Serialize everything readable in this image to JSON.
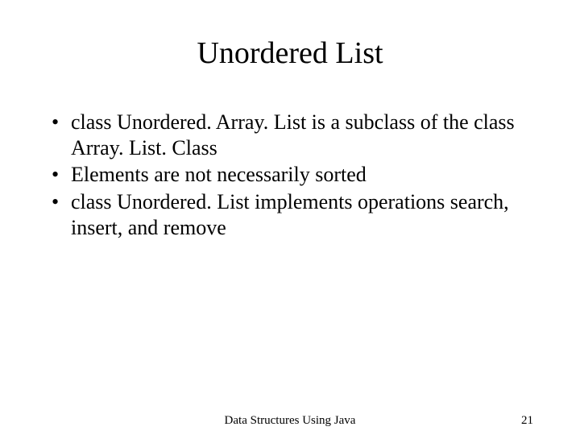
{
  "title": "Unordered List",
  "bullets": [
    "class Unordered. Array. List is a subclass of the class Array. List. Class",
    "Elements are not necessarily sorted",
    "class Unordered. List implements operations search, insert, and remove"
  ],
  "footer": {
    "center": "Data Structures Using Java",
    "page": "21"
  }
}
